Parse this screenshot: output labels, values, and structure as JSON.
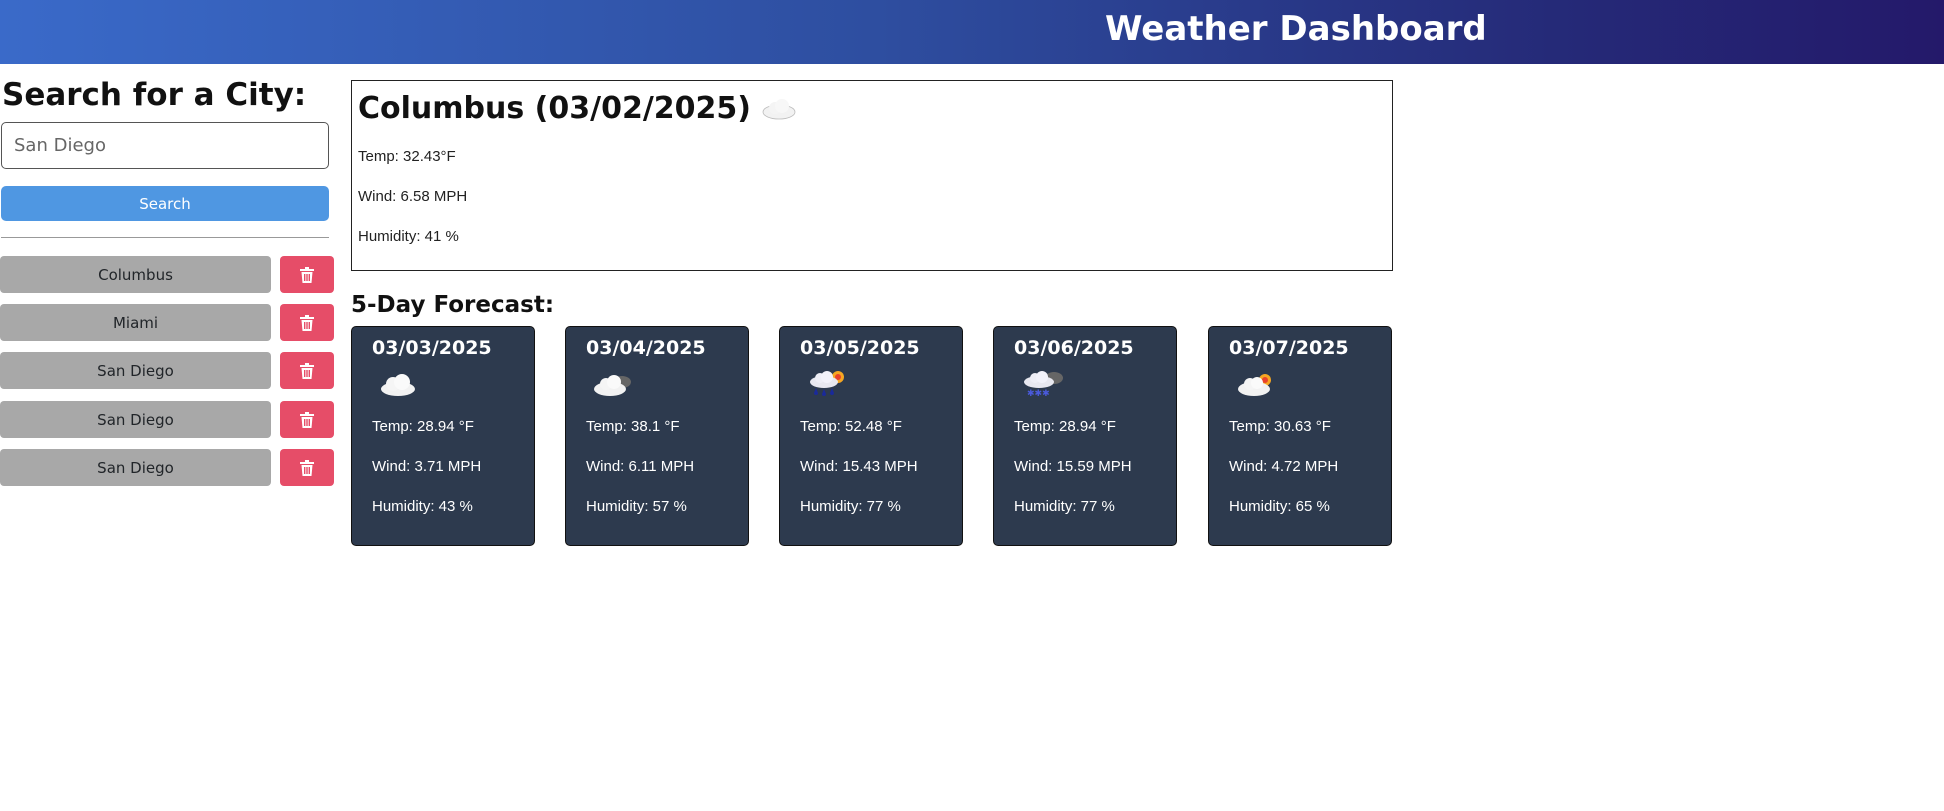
{
  "header": {
    "title": "Weather Dashboard"
  },
  "sidebar": {
    "heading": "Search for a City:",
    "search_placeholder": "San Diego",
    "search_button": "Search",
    "history": [
      {
        "label": "Columbus"
      },
      {
        "label": "Miami"
      },
      {
        "label": "San Diego"
      },
      {
        "label": "San Diego"
      },
      {
        "label": "San Diego"
      }
    ],
    "delete_icon": "trash-icon"
  },
  "current": {
    "title": "Columbus (03/02/2025)",
    "icon": "cloud-icon",
    "temp": "Temp: 32.43°F",
    "wind": "Wind: 6.58 MPH",
    "humidity": "Humidity: 41 %"
  },
  "forecast": {
    "title": "5-Day Forecast:",
    "days": [
      {
        "date": "03/03/2025",
        "icon": "cloud-icon",
        "temp": "Temp: 28.94 °F",
        "wind": "Wind: 3.71 MPH",
        "humidity": "Humidity: 43 %"
      },
      {
        "date": "03/04/2025",
        "icon": "cloud-moon-icon",
        "temp": "Temp: 38.1 °F",
        "wind": "Wind: 6.11 MPH",
        "humidity": "Humidity: 57 %"
      },
      {
        "date": "03/05/2025",
        "icon": "rain-sun-icon",
        "temp": "Temp: 52.48 °F",
        "wind": "Wind: 15.43 MPH",
        "humidity": "Humidity: 77 %"
      },
      {
        "date": "03/06/2025",
        "icon": "snow-moon-icon",
        "temp": "Temp: 28.94 °F",
        "wind": "Wind: 15.59 MPH",
        "humidity": "Humidity: 77 %"
      },
      {
        "date": "03/07/2025",
        "icon": "cloud-sun-icon",
        "temp": "Temp: 30.63 °F",
        "wind": "Wind: 4.72 MPH",
        "humidity": "Humidity: 65 %"
      }
    ]
  },
  "colors": {
    "header_start": "#3a6ac9",
    "header_end": "#24196a",
    "search_button": "#4f97e2",
    "history_button": "#a8a8a8",
    "delete_button": "#e64d68",
    "card_bg": "#2d3a4e"
  }
}
